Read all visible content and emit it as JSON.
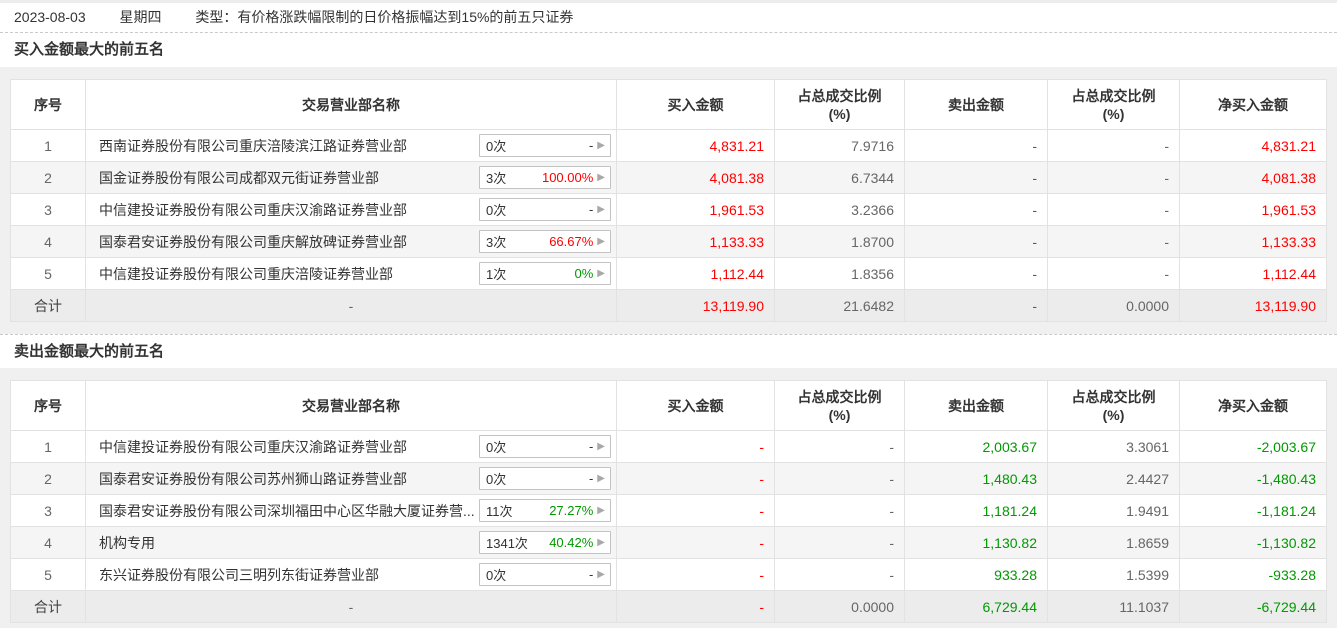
{
  "topbar": {
    "date": "2023-08-03",
    "weekday": "星期四",
    "type_text": "类型：有价格涨跌幅限制的日价格振幅达到15%的前五只证券"
  },
  "icons": {
    "expand_arrow": "▶"
  },
  "colors": {
    "up_red": "#ff0000",
    "down_green": "#009900",
    "neutral_grey": "#666666"
  },
  "columns": {
    "no": "序号",
    "name": "交易营业部名称",
    "buy": "买入金额",
    "ratio_l1": "占总成交比例",
    "ratio_l2": "(%)",
    "sell": "卖出金额",
    "net": "净买入金额"
  },
  "sections": [
    {
      "title": "买入金额最大的前五名",
      "rows": [
        {
          "no": "1",
          "name": "西南证券股份有限公司重庆涪陵滨江路证券营业部",
          "times": "0次",
          "pct": "-",
          "pct_color": "dark",
          "buy": "4,831.21",
          "buy_ratio": "7.9716",
          "sell": "-",
          "sell_ratio": "-",
          "net": "4,831.21"
        },
        {
          "no": "2",
          "name": "国金证券股份有限公司成都双元街证券营业部",
          "times": "3次",
          "pct": "100.00%",
          "pct_color": "red",
          "buy": "4,081.38",
          "buy_ratio": "6.7344",
          "sell": "-",
          "sell_ratio": "-",
          "net": "4,081.38"
        },
        {
          "no": "3",
          "name": "中信建投证券股份有限公司重庆汉渝路证券营业部",
          "times": "0次",
          "pct": "-",
          "pct_color": "dark",
          "buy": "1,961.53",
          "buy_ratio": "3.2366",
          "sell": "-",
          "sell_ratio": "-",
          "net": "1,961.53"
        },
        {
          "no": "4",
          "name": "国泰君安证券股份有限公司重庆解放碑证券营业部",
          "times": "3次",
          "pct": "66.67%",
          "pct_color": "red",
          "buy": "1,133.33",
          "buy_ratio": "1.8700",
          "sell": "-",
          "sell_ratio": "-",
          "net": "1,133.33"
        },
        {
          "no": "5",
          "name": "中信建投证券股份有限公司重庆涪陵证券营业部",
          "times": "1次",
          "pct": "0%",
          "pct_color": "green",
          "buy": "1,112.44",
          "buy_ratio": "1.8356",
          "sell": "-",
          "sell_ratio": "-",
          "net": "1,112.44"
        }
      ],
      "total": {
        "no": "合计",
        "name": "-",
        "buy": "13,119.90",
        "buy_ratio": "21.6482",
        "sell": "-",
        "sell_ratio": "0.0000",
        "net": "13,119.90"
      }
    },
    {
      "title": "卖出金额最大的前五名",
      "rows": [
        {
          "no": "1",
          "name": "中信建投证券股份有限公司重庆汉渝路证券营业部",
          "times": "0次",
          "pct": "-",
          "pct_color": "dark",
          "buy": "-",
          "buy_ratio": "-",
          "sell": "2,003.67",
          "sell_ratio": "3.3061",
          "net": "-2,003.67"
        },
        {
          "no": "2",
          "name": "国泰君安证券股份有限公司苏州狮山路证券营业部",
          "times": "0次",
          "pct": "-",
          "pct_color": "dark",
          "buy": "-",
          "buy_ratio": "-",
          "sell": "1,480.43",
          "sell_ratio": "2.4427",
          "net": "-1,480.43"
        },
        {
          "no": "3",
          "name": "国泰君安证券股份有限公司深圳福田中心区华融大厦证券营...",
          "times": "11次",
          "pct": "27.27%",
          "pct_color": "green",
          "buy": "-",
          "buy_ratio": "-",
          "sell": "1,181.24",
          "sell_ratio": "1.9491",
          "net": "-1,181.24"
        },
        {
          "no": "4",
          "name": "机构专用",
          "times": "1341次",
          "pct": "40.42%",
          "pct_color": "green",
          "buy": "-",
          "buy_ratio": "-",
          "sell": "1,130.82",
          "sell_ratio": "1.8659",
          "net": "-1,130.82"
        },
        {
          "no": "5",
          "name": "东兴证券股份有限公司三明列东街证券营业部",
          "times": "0次",
          "pct": "-",
          "pct_color": "dark",
          "buy": "-",
          "buy_ratio": "-",
          "sell": "933.28",
          "sell_ratio": "1.5399",
          "net": "-933.28"
        }
      ],
      "total": {
        "no": "合计",
        "name": "-",
        "buy": "-",
        "buy_ratio": "0.0000",
        "sell": "6,729.44",
        "sell_ratio": "11.1037",
        "net": "-6,729.44"
      }
    }
  ]
}
